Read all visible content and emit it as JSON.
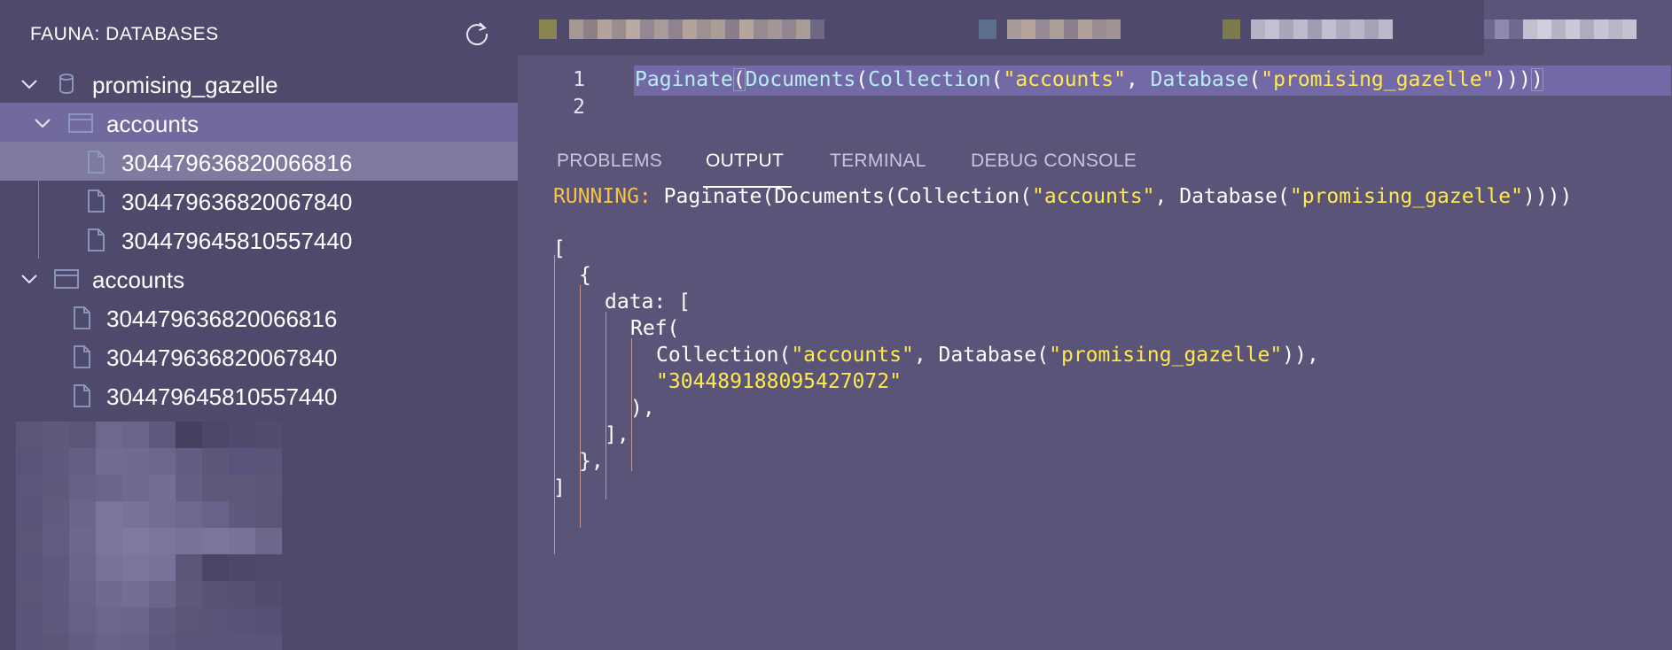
{
  "sidebar": {
    "title": "FAUNA: DATABASES",
    "refresh_icon": "refresh-icon",
    "tree": [
      {
        "depth": 0,
        "type": "database",
        "label": "promising_gazelle",
        "expanded": true
      },
      {
        "depth": 1,
        "type": "collection",
        "label": "accounts",
        "expanded": true,
        "selected": true
      },
      {
        "depth": 2,
        "type": "document",
        "label": "304479636820066816",
        "focused": true
      },
      {
        "depth": 2,
        "type": "document",
        "label": "304479636820067840"
      },
      {
        "depth": 2,
        "type": "document",
        "label": "304479645810557440"
      },
      {
        "depth": 0,
        "type": "collection",
        "label": "accounts",
        "expanded": true
      },
      {
        "depth": 1,
        "type": "document",
        "label": "304479636820066816"
      },
      {
        "depth": 1,
        "type": "document",
        "label": "304479636820067840"
      },
      {
        "depth": 1,
        "type": "document",
        "label": "304479645810557440"
      }
    ]
  },
  "editor": {
    "lines": [
      {
        "number": "1"
      },
      {
        "number": "2"
      }
    ],
    "code": {
      "fn_paginate": "Paginate",
      "fn_documents": "Documents",
      "fn_collection": "Collection",
      "str_accounts": "\"accounts\"",
      "fn_database": "Database",
      "str_db": "\"promising_gazelle\""
    }
  },
  "panel": {
    "tabs": [
      {
        "label": "PROBLEMS",
        "active": false
      },
      {
        "label": "OUTPUT",
        "active": true
      },
      {
        "label": "TERMINAL",
        "active": false
      },
      {
        "label": "DEBUG CONSOLE",
        "active": false
      }
    ],
    "output": {
      "running_label": "RUNNING:",
      "running_pre": " Paginate(Documents(Collection(",
      "running_str1": "\"accounts\"",
      "running_mid": ", Database(",
      "running_str2": "\"promising_gazelle\"",
      "running_post": "))))",
      "l_open_bracket": "[",
      "l_open_brace": "{",
      "l_data": "data: [",
      "l_ref": "Ref(",
      "l_coll_pre": "Collection(",
      "l_coll_str1": "\"accounts\"",
      "l_coll_mid": ", Database(",
      "l_coll_str2": "\"promising_gazelle\"",
      "l_coll_post": ")),",
      "l_id": "\"304489188095427072\"",
      "l_ref_close": "),",
      "l_data_close": "],",
      "l_brace_close": "},",
      "l_bracket_close": "]"
    }
  },
  "colors": {
    "background": "#5a5478",
    "sidebar": "#4f4a6b",
    "selection": "#716a9e",
    "string": "#ffe94d",
    "running": "#f6c344",
    "function": "#b7ecf3"
  }
}
